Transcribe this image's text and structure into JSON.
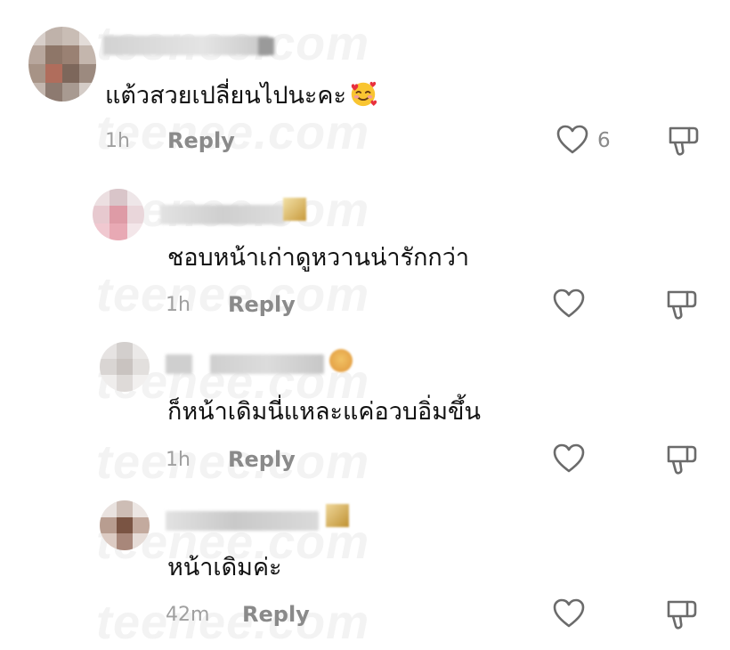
{
  "watermark": "teenee.com",
  "comments": [
    {
      "comment": "แต้วสวยเปลี่ยนไปนะคะ",
      "emoji": "smiling-face-with-hearts",
      "time": "1h",
      "reply": "Reply",
      "likes": "6"
    },
    {
      "comment": "ชอบหน้าเก่าดูหวานน่ารักกว่า",
      "time": "1h",
      "reply": "Reply"
    },
    {
      "comment": "ก็หน้าเดิมนี่แหละแค่อวบอิ่มขึ้น",
      "time": "1h",
      "reply": "Reply"
    },
    {
      "comment": "หน้าเดิมค่ะ",
      "time": "42m",
      "reply": "Reply"
    }
  ],
  "colors": {
    "icon": "#6b6b6b",
    "meta": "#a0a0a0",
    "reply": "#8a8a8a"
  }
}
